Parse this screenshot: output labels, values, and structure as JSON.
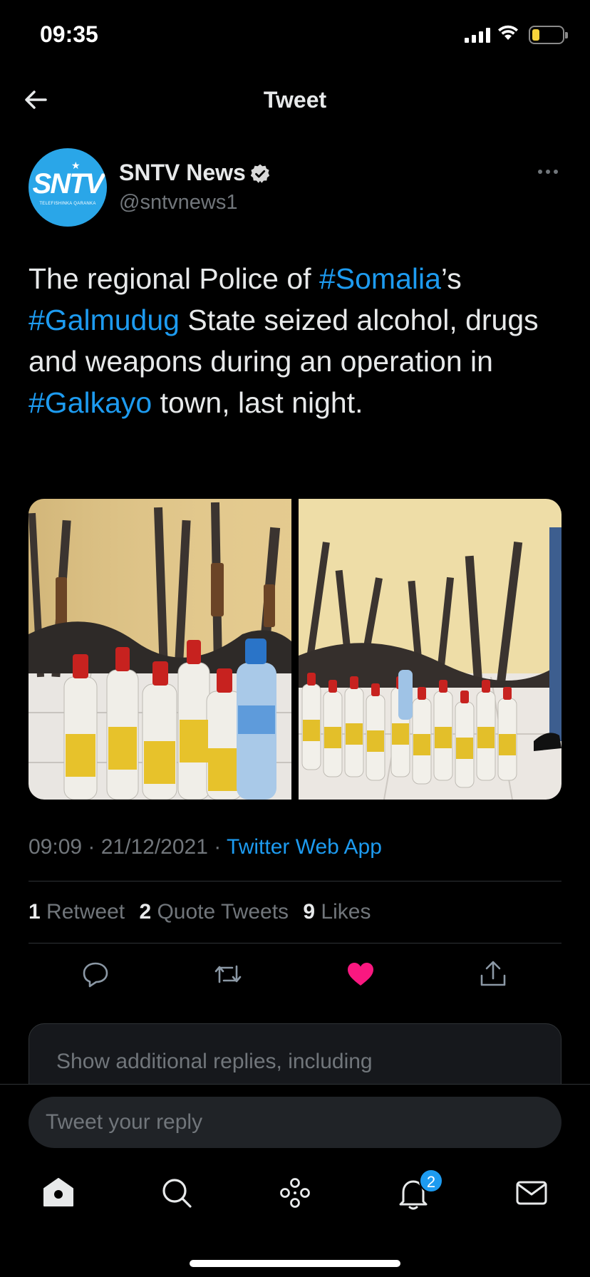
{
  "status_bar": {
    "time": "09:35"
  },
  "header": {
    "title": "Tweet"
  },
  "tweet": {
    "author": {
      "name": "SNTV News",
      "handle": "@sntvnews1",
      "avatar_text": "SNTV",
      "avatar_subtext": "TELEFISHINKA QARANKA",
      "avatar_color": "#2aa6e8"
    },
    "text": {
      "part1": "The regional Police of ",
      "hashtag1": "#Somalia",
      "part2": "’s ",
      "hashtag2": "#Galmudug",
      "part3": " State seized alcohol, drugs and weapons during an operation in ",
      "hashtag3": "#Galkayo",
      "part4": " town, last night."
    },
    "meta": {
      "time": "09:09",
      "separator": " · ",
      "date": "21/12/2021",
      "source": "Twitter Web App"
    },
    "stats": {
      "retweets_count": "1",
      "retweets_label": "Retweet",
      "quotes_count": "2",
      "quotes_label": "Quote Tweets",
      "likes_count": "9",
      "likes_label": "Likes"
    },
    "liked": true
  },
  "more_replies": {
    "text": "Show additional replies, including"
  },
  "composer": {
    "placeholder": "Tweet your reply"
  },
  "tab_bar": {
    "notifications_badge": "2"
  },
  "colors": {
    "background": "#000000",
    "accent": "#1d9bf0",
    "like": "#f91880",
    "muted": "#71767b"
  }
}
